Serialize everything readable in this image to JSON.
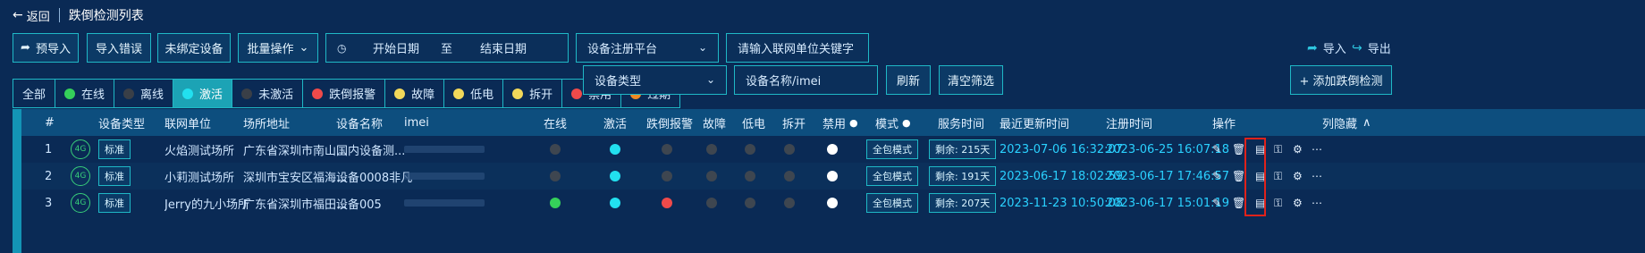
{
  "header": {
    "back_label": "返回",
    "title": "跌倒检测列表"
  },
  "toolbar": {
    "pre_import": "预导入",
    "import_errors": "导入错误",
    "unbound_devices": "未绑定设备",
    "batch_ops": "批量操作",
    "date_start": "开始日期",
    "date_to": "至",
    "date_end": "结束日期",
    "platform_placeholder": "设备注册平台",
    "unit_keyword_placeholder": "请输入联网单位关键字",
    "import": "导入",
    "export": "导出"
  },
  "filters": {
    "segments": [
      {
        "label": "全部",
        "dot": ""
      },
      {
        "label": "在线",
        "dot": "#35d05a"
      },
      {
        "label": "离线",
        "dot": "#3a3f47"
      },
      {
        "label": "激活",
        "dot": "#22e0ef",
        "active": true
      },
      {
        "label": "未激活",
        "dot": "#3a3f47"
      },
      {
        "label": "跌倒报警",
        "dot": "#ef4a4a"
      },
      {
        "label": "故障",
        "dot": "#f2d85a"
      },
      {
        "label": "低电",
        "dot": "#f2d85a"
      },
      {
        "label": "拆开",
        "dot": "#f2d85a"
      },
      {
        "label": "禁用",
        "dot": "#ef4a4a"
      },
      {
        "label": "过期",
        "dot": "#f08a22"
      }
    ],
    "device_type_placeholder": "设备类型",
    "device_name_placeholder": "设备名称/imei",
    "refresh": "刷新",
    "clear": "清空筛选",
    "add": "+ 添加跌倒检测"
  },
  "table": {
    "headers": {
      "no": "#",
      "type": "设备类型",
      "unit": "联网单位",
      "addr": "场所地址",
      "name": "设备名称",
      "imei": "imei",
      "online": "在线",
      "active": "激活",
      "fall": "跌倒报警",
      "fault": "故障",
      "low": "低电",
      "open": "拆开",
      "disabled": "禁用",
      "mode": "模式",
      "service": "服务时间",
      "updated": "最近更新时间",
      "registered": "注册时间",
      "ops": "操作",
      "hide": "列隐藏"
    },
    "rows": [
      {
        "no": "1",
        "net": "4G",
        "type": "标准",
        "unit": "火焰测试场所",
        "addr": "广东省深圳市南山...",
        "name": "国内设备测...",
        "online": "#3e4650",
        "active": "#22e0ef",
        "fall": "#3e4650",
        "fault": "#3e4650",
        "low": "#3e4650",
        "open": "#3e4650",
        "disabled": "#ffffff",
        "mode": "全包模式",
        "service": "剩余: 215天",
        "updated": "2023-07-06 16:32:07",
        "registered": "2023-06-25 16:07:18"
      },
      {
        "no": "2",
        "net": "4G",
        "type": "标准",
        "unit": "小莉测试场所",
        "addr": "深圳市宝安区福海...",
        "name": "设备0008非凡",
        "online": "#3e4650",
        "active": "#22e0ef",
        "fall": "#3e4650",
        "fault": "#3e4650",
        "low": "#3e4650",
        "open": "#3e4650",
        "disabled": "#ffffff",
        "mode": "全包模式",
        "service": "剩余: 191天",
        "updated": "2023-06-17 18:02:59",
        "registered": "2023-06-17 17:46:57"
      },
      {
        "no": "3",
        "net": "4G",
        "type": "标准",
        "unit": "Jerry的九小场所",
        "addr": "广东省深圳市福田...",
        "name": "设备005",
        "online": "#35d05a",
        "active": "#22e0ef",
        "fall": "#ef4a4a",
        "fault": "#3e4650",
        "low": "#3e4650",
        "open": "#3e4650",
        "disabled": "#ffffff",
        "mode": "全包模式",
        "service": "剩余: 207天",
        "updated": "2023-11-23 10:50:08",
        "registered": "2023-06-17 15:01:19"
      }
    ]
  }
}
